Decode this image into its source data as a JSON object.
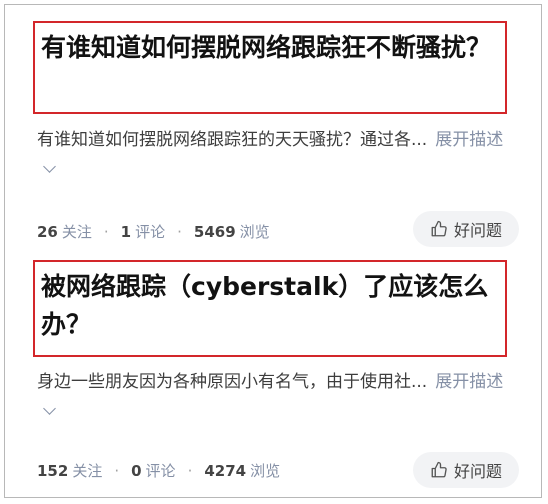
{
  "questions": [
    {
      "title": "有谁知道如何摆脱网络跟踪狂不断骚扰？",
      "excerpt": "有谁知道如何摆脱网络跟踪狂的天天骚扰？通过各...",
      "expand_label": "展开描述",
      "followers": "26",
      "followers_label": "关注",
      "comments": "1",
      "comments_label": "评论",
      "views": "5469",
      "views_label": "浏览",
      "good_label": "好问题"
    },
    {
      "title": "被网络跟踪（cyberstalk）了应该怎么办？",
      "excerpt": "身边一些朋友因为各种原因小有名气，由于使用社...",
      "expand_label": "展开描述",
      "followers": "152",
      "followers_label": "关注",
      "comments": "0",
      "comments_label": "评论",
      "views": "4274",
      "views_label": "浏览",
      "good_label": "好问题"
    }
  ],
  "colors": {
    "highlight": "#d3262a",
    "meta": "#8590a6",
    "button_bg": "#f2f3f5"
  }
}
